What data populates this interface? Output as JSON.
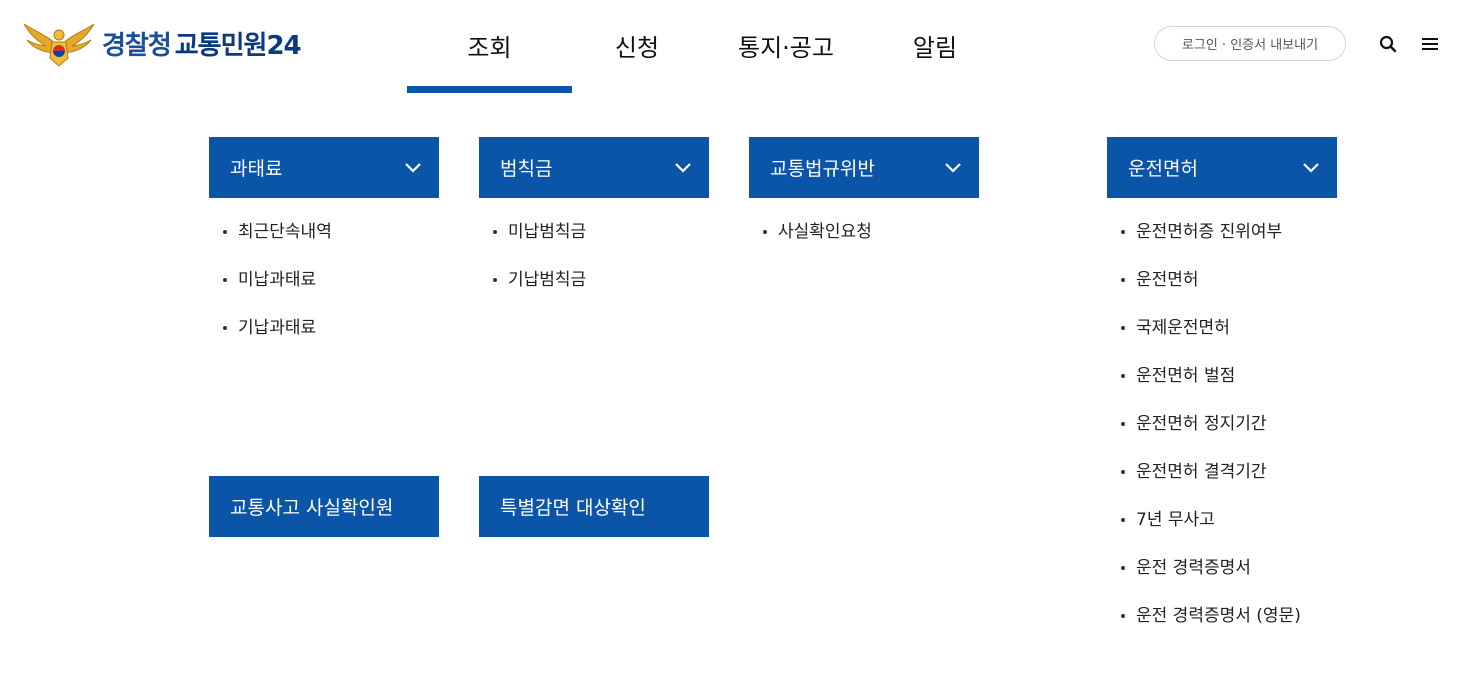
{
  "header": {
    "logo_text_a": "경찰청",
    "logo_text_b": "교통민원24",
    "nav": [
      {
        "label": "조회",
        "active": true
      },
      {
        "label": "신청"
      },
      {
        "label": "통지·공고"
      },
      {
        "label": "알림"
      }
    ],
    "login_label": "로그인 · 인증서 내보내기"
  },
  "panels": {
    "fine": {
      "title": "과태료",
      "items": [
        "최근단속내역",
        "미납과태료",
        "기납과태료"
      ]
    },
    "penalty": {
      "title": "범칙금",
      "items": [
        "미납범칙금",
        "기납범칙금"
      ]
    },
    "violation": {
      "title": "교통법규위반",
      "items": [
        "사실확인요청"
      ]
    },
    "license": {
      "title": "운전면허",
      "items": [
        "운전면허증 진위여부",
        "운전면허",
        "국제운전면허",
        "운전면허 벌점",
        "운전면허 정지기간",
        "운전면허 결격기간",
        "7년 무사고",
        "운전 경력증명서",
        "운전 경력증명서 (영문)"
      ]
    },
    "accident": {
      "title": "교통사고 사실확인원"
    },
    "special": {
      "title": "특별감면 대상확인"
    }
  },
  "colors": {
    "primary": "#0a55a7",
    "logo": "#1a4f9c"
  },
  "icons": {
    "search": "search-icon",
    "menu": "hamburger-menu-icon",
    "chevron": "chevron-down-icon",
    "emblem": "police-emblem-icon"
  }
}
